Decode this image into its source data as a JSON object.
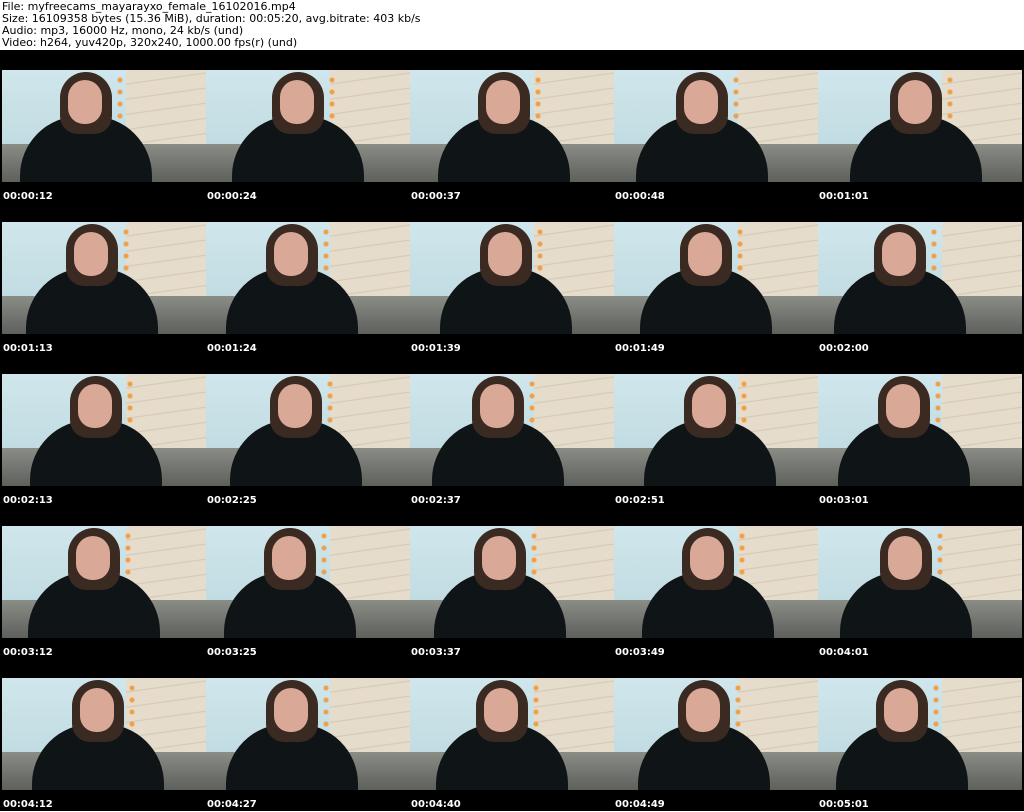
{
  "header": {
    "file_line": "File: myfreecams_mayarayxo_female_16102016.mp4",
    "size_line": "Size: 16109358 bytes (15.36 MiB), duration: 00:05:20, avg.bitrate: 403 kb/s",
    "audio_line": "Audio: mp3, 16000 Hz, mono, 24 kb/s (und)",
    "video_line": "Video: h264, yuv420p, 320x240, 1000.00 fps(r) (und)"
  },
  "grid": {
    "columns": 5,
    "rows": 5
  },
  "thumbnails": [
    {
      "timestamp": "00:00:12"
    },
    {
      "timestamp": "00:00:24"
    },
    {
      "timestamp": "00:00:37"
    },
    {
      "timestamp": "00:00:48"
    },
    {
      "timestamp": "00:01:01"
    },
    {
      "timestamp": "00:01:13"
    },
    {
      "timestamp": "00:01:24"
    },
    {
      "timestamp": "00:01:39"
    },
    {
      "timestamp": "00:01:49"
    },
    {
      "timestamp": "00:02:00"
    },
    {
      "timestamp": "00:02:13"
    },
    {
      "timestamp": "00:02:25"
    },
    {
      "timestamp": "00:02:37"
    },
    {
      "timestamp": "00:02:51"
    },
    {
      "timestamp": "00:03:01"
    },
    {
      "timestamp": "00:03:12"
    },
    {
      "timestamp": "00:03:25"
    },
    {
      "timestamp": "00:03:37"
    },
    {
      "timestamp": "00:03:49"
    },
    {
      "timestamp": "00:04:01"
    },
    {
      "timestamp": "00:04:12"
    },
    {
      "timestamp": "00:04:27"
    },
    {
      "timestamp": "00:04:40"
    },
    {
      "timestamp": "00:04:49"
    },
    {
      "timestamp": "00:05:01"
    }
  ],
  "colors": {
    "sheet_background": "#000000",
    "timestamp_text": "#ffffff",
    "header_text": "#000000"
  }
}
